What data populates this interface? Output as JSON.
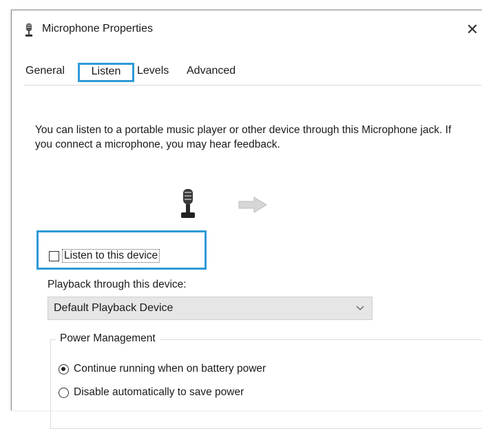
{
  "window": {
    "title": "Microphone Properties",
    "close_glyph": "✕"
  },
  "tabs": [
    {
      "label": "General",
      "active": false
    },
    {
      "label": "Listen",
      "active": true
    },
    {
      "label": "Levels",
      "active": false
    },
    {
      "label": "Advanced",
      "active": false
    }
  ],
  "listen": {
    "description": "You can listen to a portable music player or other device through this Microphone jack.  If you connect a microphone, you may hear feedback.",
    "listen_checkbox": {
      "label": "Listen to this device",
      "checked": false
    },
    "playback_label": "Playback through this device:",
    "playback_select": {
      "value": "Default Playback Device"
    },
    "power": {
      "title": "Power Management",
      "options": [
        {
          "label": "Continue running when on battery power",
          "selected": true
        },
        {
          "label": "Disable automatically to save power",
          "selected": false
        }
      ]
    }
  },
  "colors": {
    "highlight": "#2e9ad6"
  },
  "icons": {
    "title": "microphone-icon",
    "device": "microphone-icon",
    "flow": "arrow-right-icon",
    "dropdown": "chevron-down-icon"
  }
}
